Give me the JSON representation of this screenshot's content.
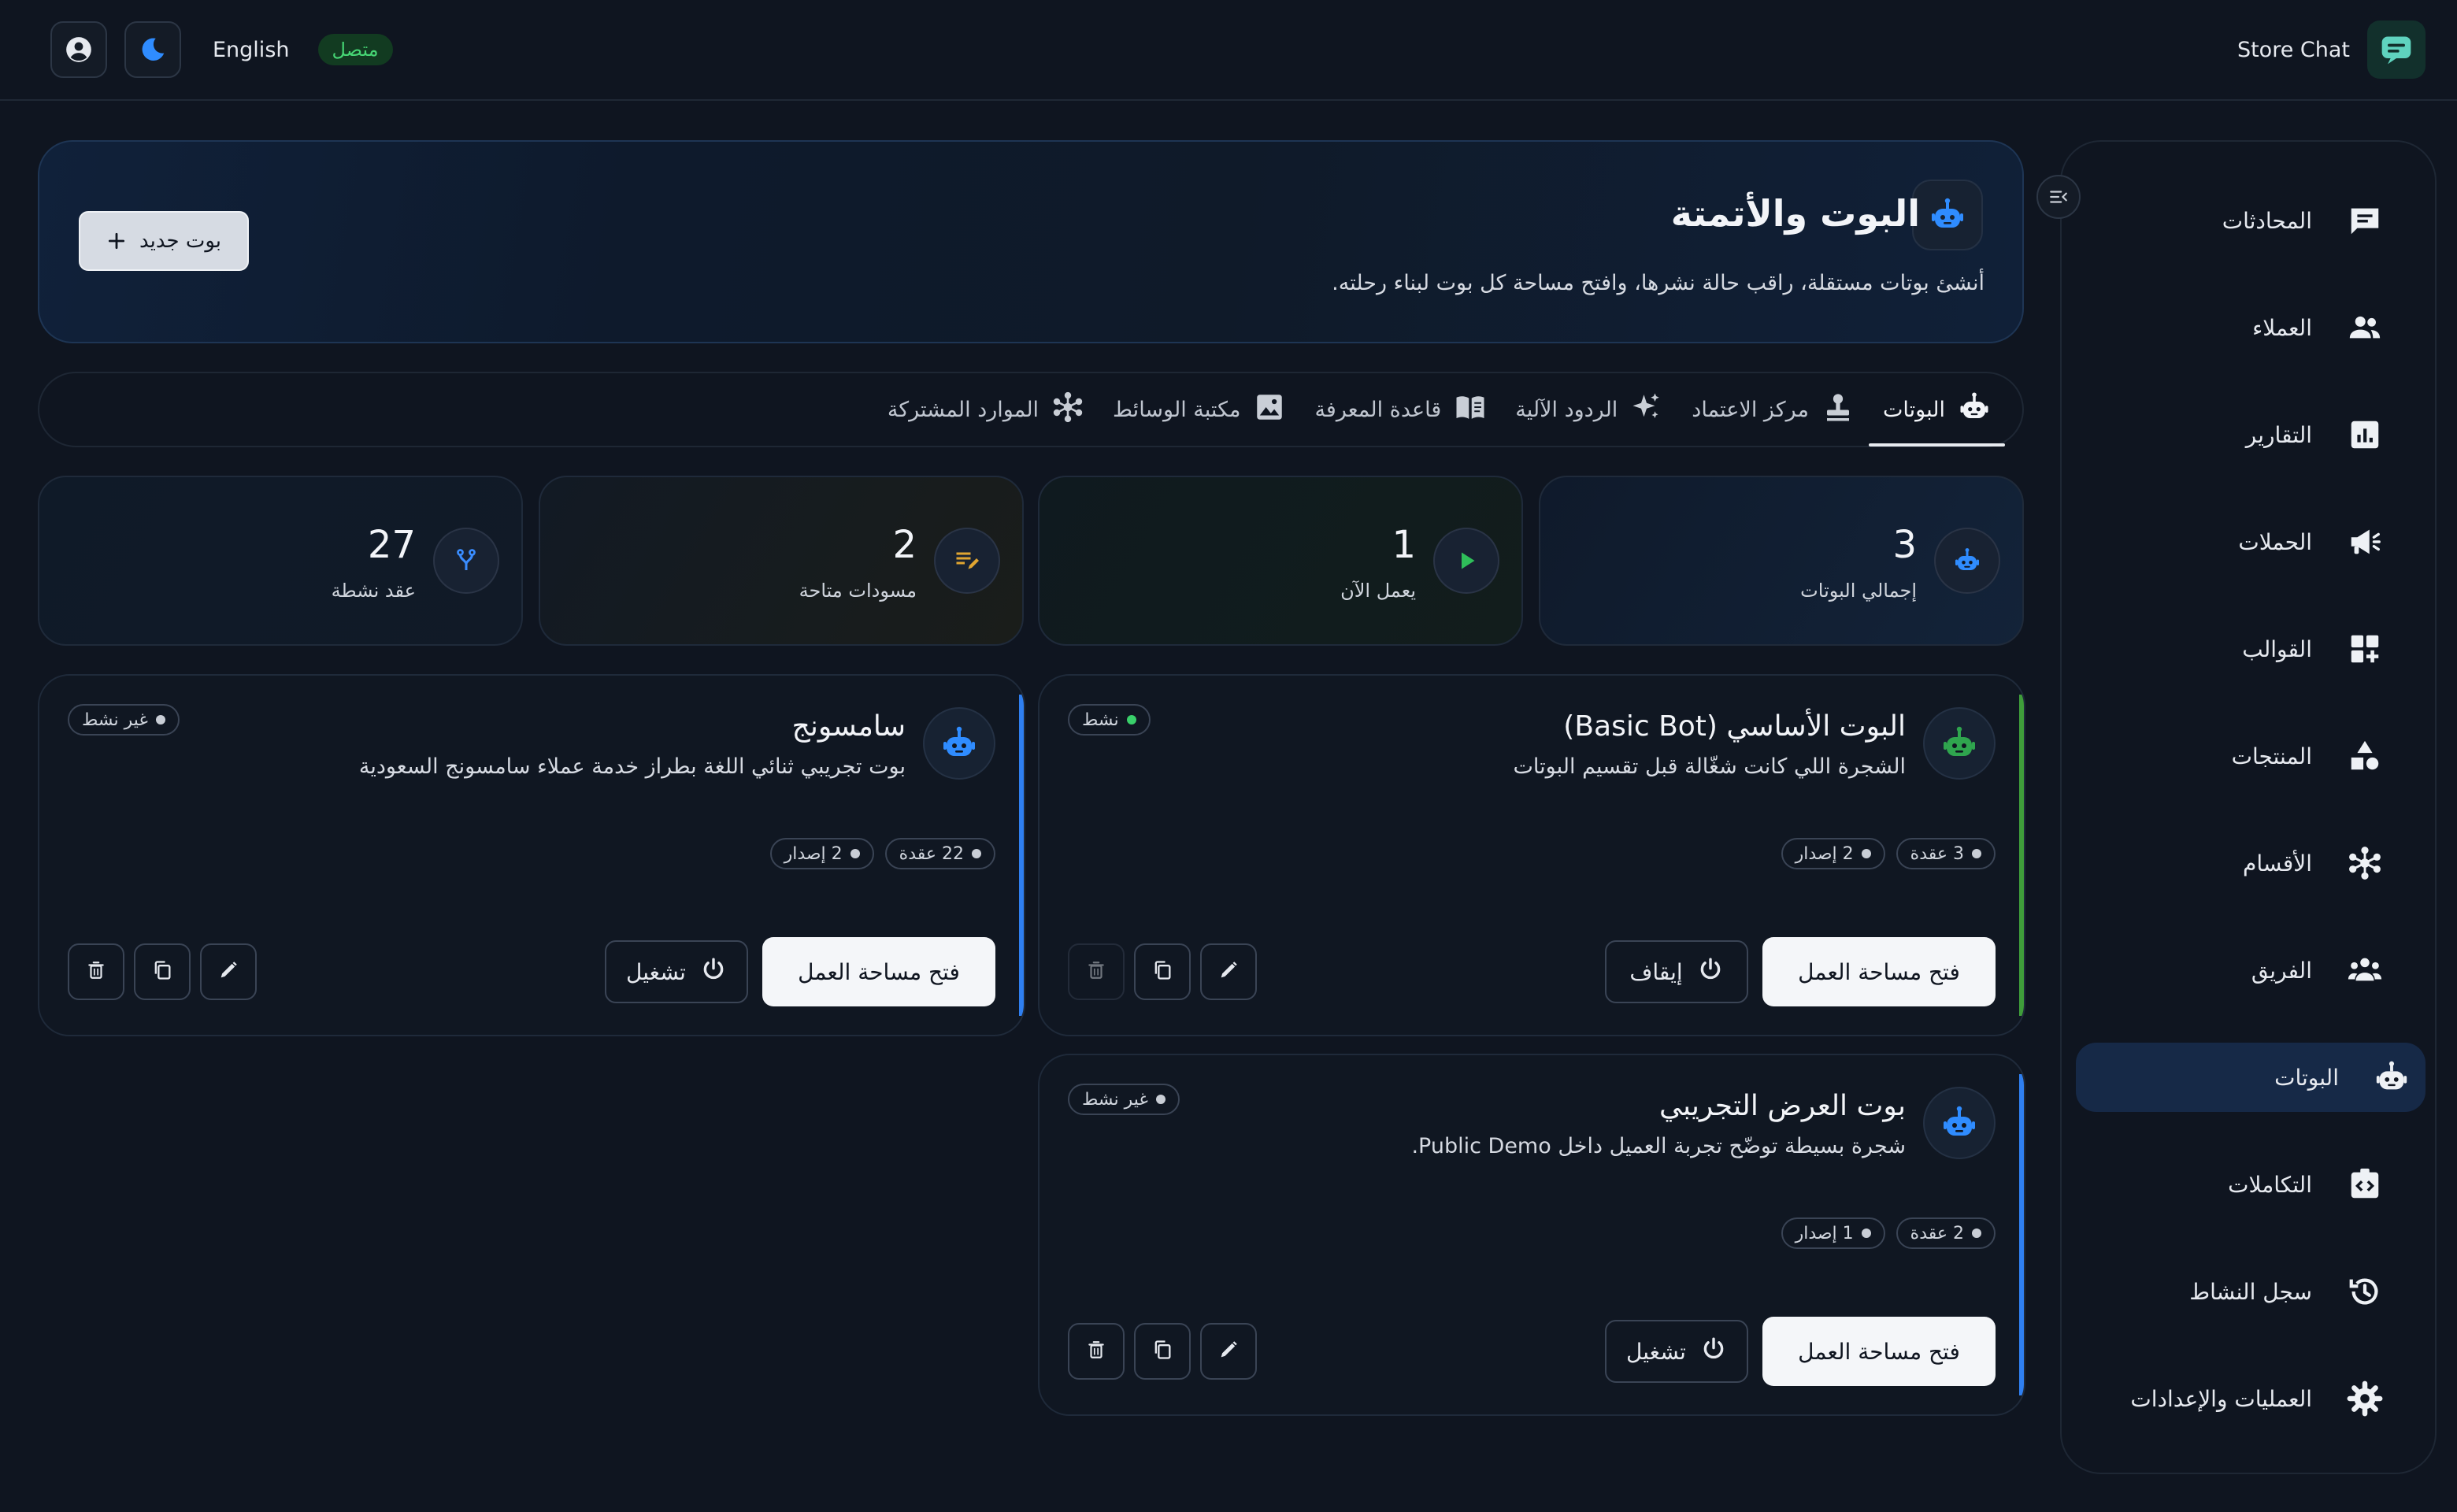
{
  "topbar": {
    "brand": "Store Chat",
    "language": "English",
    "status": "متصل"
  },
  "sidebar": {
    "items": [
      {
        "label": "المحادثات",
        "icon": "chat-icon"
      },
      {
        "label": "العملاء",
        "icon": "users-icon"
      },
      {
        "label": "التقارير",
        "icon": "report-icon"
      },
      {
        "label": "الحملات",
        "icon": "megaphone-icon"
      },
      {
        "label": "القوالب",
        "icon": "templates-icon"
      },
      {
        "label": "المنتجات",
        "icon": "shapes-icon"
      },
      {
        "label": "الأقسام",
        "icon": "hub-icon"
      },
      {
        "label": "الفريق",
        "icon": "team-icon"
      },
      {
        "label": "البوتات",
        "icon": "bot-icon"
      },
      {
        "label": "التكاملات",
        "icon": "integration-icon"
      },
      {
        "label": "سجل النشاط",
        "icon": "history-icon"
      },
      {
        "label": "العمليات والإعدادات",
        "icon": "gear-icon"
      }
    ],
    "active_index": 8
  },
  "hero": {
    "title": "البوت والأتمتة",
    "subtitle": "أنشئ بوتات مستقلة، راقب حالة نشرها، وافتح مساحة كل بوت لبناء رحلته.",
    "new_bot_label": "بوت جديد"
  },
  "tabs": [
    {
      "label": "البوتات",
      "icon": "bot-icon",
      "active": true
    },
    {
      "label": "مركز الاعتماد",
      "icon": "stamp-icon",
      "active": false
    },
    {
      "label": "الردود الآلية",
      "icon": "sparkle-icon",
      "active": false
    },
    {
      "label": "قاعدة المعرفة",
      "icon": "book-icon",
      "active": false
    },
    {
      "label": "مكتبة الوسائط",
      "icon": "image-icon",
      "active": false
    },
    {
      "label": "الموارد المشتركة",
      "icon": "hub-icon",
      "active": false
    }
  ],
  "stats": [
    {
      "value": "3",
      "label": "إجمالي البوتات",
      "icon": "bot-icon",
      "color": "#2f8cff"
    },
    {
      "value": "1",
      "label": "يعمل الآن",
      "icon": "play-icon",
      "color": "#2fbf5a"
    },
    {
      "value": "2",
      "label": "مسودات متاحة",
      "icon": "edit-note-icon",
      "color": "#e0a531"
    },
    {
      "value": "27",
      "label": "عقد نشطة",
      "icon": "fork-icon",
      "color": "#3a8dff"
    }
  ],
  "bots": [
    {
      "title": "البوت الأساسي (Basic Bot)",
      "description": "الشجرة اللي كانت شغّالة قبل تقسيم البوتات",
      "status": "نشط",
      "status_color": "#39d06a",
      "nodes": "3 عقدة",
      "versions": "2 إصدار",
      "open_label": "فتح مساحة العمل",
      "toggle_label": "إيقاف",
      "accent": "#3f9d3a",
      "icon_color": "#2fa54e"
    },
    {
      "title": "سامسونج",
      "description": "بوت تجريبي ثنائي اللغة بطراز خدمة عملاء سامسونج السعودية",
      "status": "غير نشط",
      "status_color": "#c9ced6",
      "nodes": "22 عقدة",
      "versions": "2 إصدار",
      "open_label": "فتح مساحة العمل",
      "toggle_label": "تشغيل",
      "accent": "#2f7ff0",
      "icon_color": "#2f8cff"
    },
    {
      "title": "بوت العرض التجريبي",
      "description": "شجرة بسيطة توضّح تجربة العميل داخل Public Demo.",
      "status": "غير نشط",
      "status_color": "#c9ced6",
      "nodes": "2 عقدة",
      "versions": "1 إصدار",
      "open_label": "فتح مساحة العمل",
      "toggle_label": "تشغيل",
      "accent": "#2f7ff0",
      "icon_color": "#2f8cff"
    }
  ]
}
